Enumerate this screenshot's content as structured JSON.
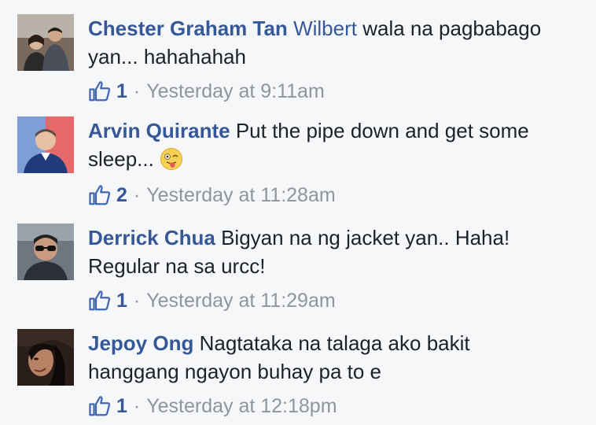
{
  "colors": {
    "name_link": "#365899",
    "text": "#1d2129",
    "meta": "#90949c",
    "background": "#f6f7f9"
  },
  "comments": [
    {
      "author": "Chester Graham Tan",
      "mention": "Wilbert",
      "text": "wala na pagbabago yan... hahahahah",
      "likes": "1",
      "separator": "·",
      "timestamp": "Yesterday at 9:11am",
      "avatar_icon": "couple-photo-avatar"
    },
    {
      "author": "Arvin Quirante",
      "text": "Put the pipe down and get some sleep...",
      "emoji": "tongue-out-emoji",
      "likes": "2",
      "separator": "·",
      "timestamp": "Yesterday at 11:28am",
      "avatar_icon": "man-flag-background-avatar"
    },
    {
      "author": "Derrick Chua",
      "text": "Bigyan na ng jacket yan.. Haha! Regular na sa urcc!",
      "likes": "1",
      "separator": "·",
      "timestamp": "Yesterday at 11:29am",
      "avatar_icon": "man-sunglasses-avatar"
    },
    {
      "author": "Jepoy Ong",
      "text": "Nagtataka na talaga ako bakit hanggang ngayon buhay pa to e",
      "likes": "1",
      "separator": "·",
      "timestamp": "Yesterday at 12:18pm",
      "avatar_icon": "dark-portrait-avatar"
    }
  ]
}
